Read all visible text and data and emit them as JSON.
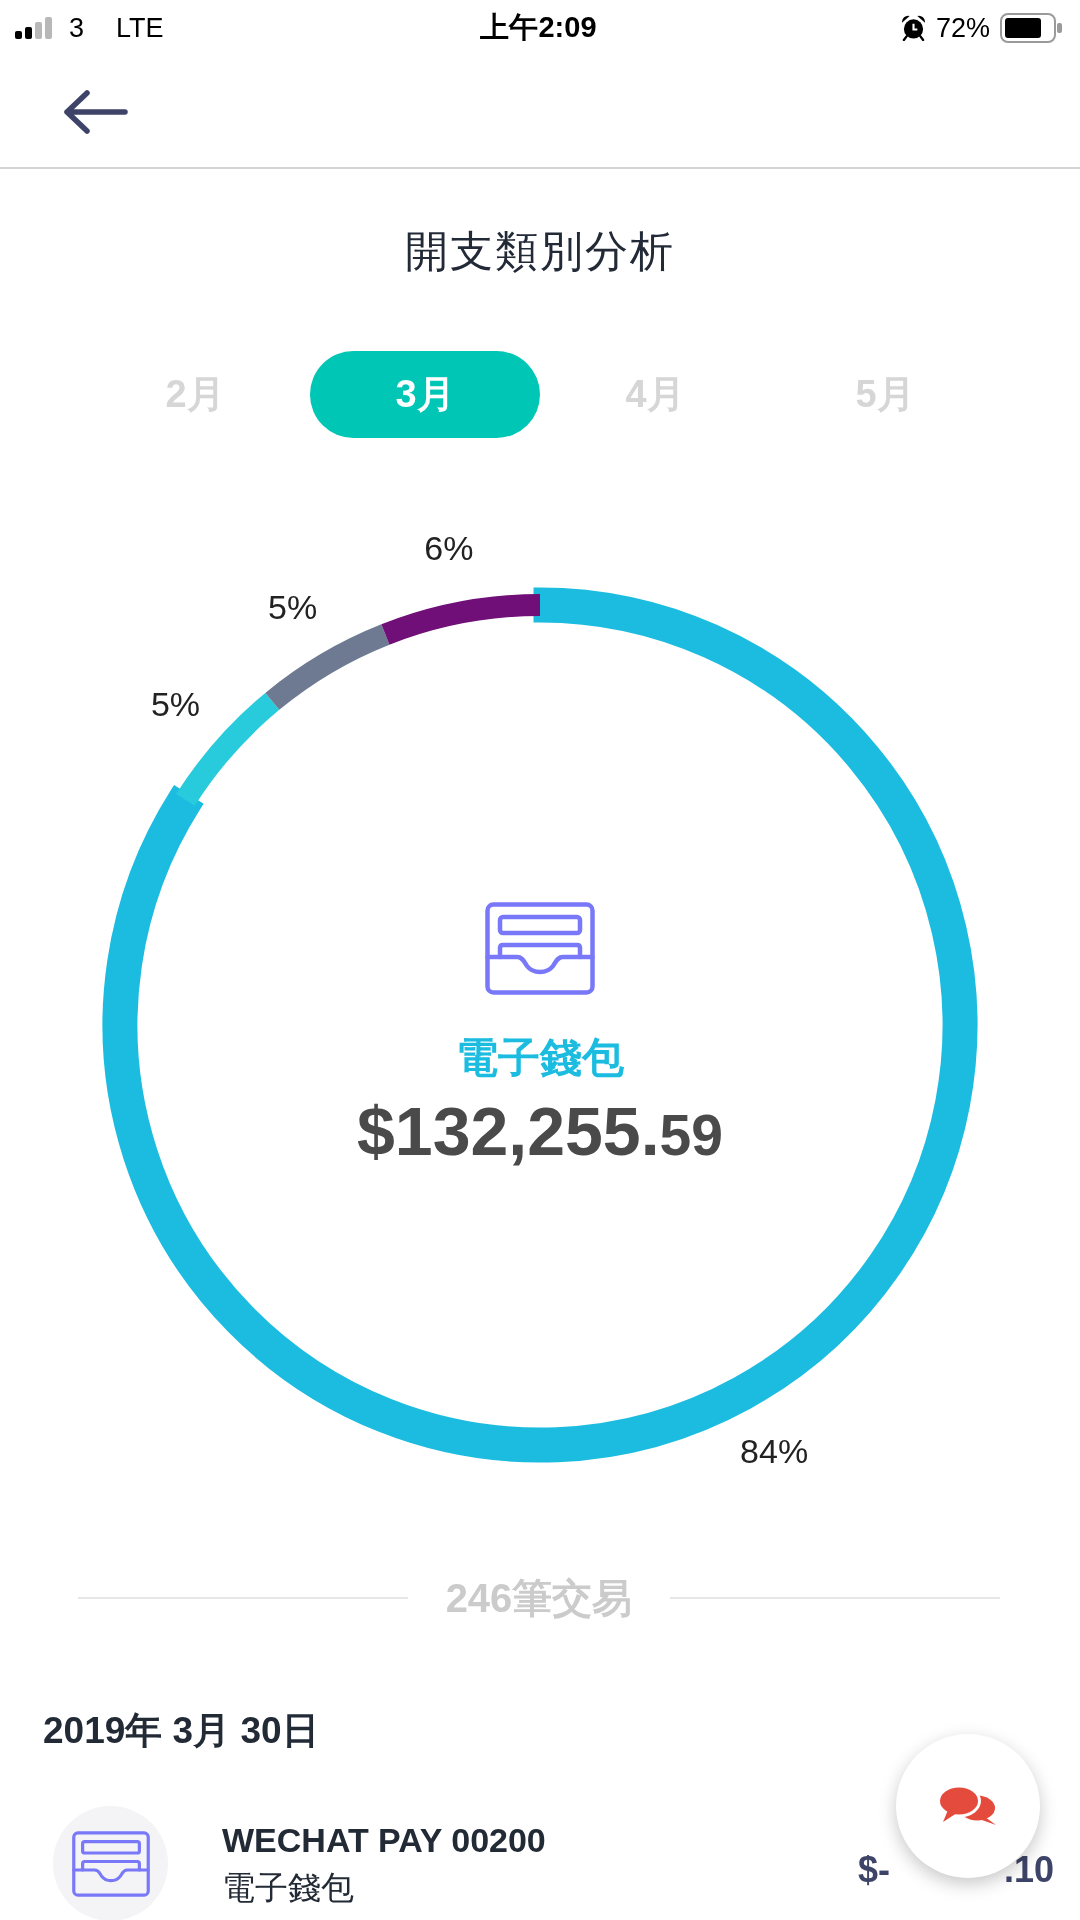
{
  "status_bar": {
    "carrier": "3",
    "network": "LTE",
    "time": "上午2:09",
    "battery": "72%"
  },
  "page_title": "開支類別分析",
  "month_tabs": [
    {
      "label": "2月",
      "selected": false
    },
    {
      "label": "3月",
      "selected": true
    },
    {
      "label": "4月",
      "selected": false
    },
    {
      "label": "5月",
      "selected": false
    }
  ],
  "chart": {
    "chart_data": {
      "type": "donut",
      "values": [
        84,
        5,
        5,
        6
      ],
      "value_labels": [
        "84%",
        "5%",
        "5%",
        "6%"
      ]
    },
    "slices": [
      {
        "color": "#1bbce0",
        "selected": true
      },
      {
        "color": "#27cbdb",
        "selected": false
      },
      {
        "color": "#6e7a92",
        "selected": false
      },
      {
        "color": "#6f0f77",
        "selected": false
      }
    ],
    "center": {
      "category": "電子錢包",
      "amount_whole": "$132,255.",
      "amount_fraction": "59"
    }
  },
  "transaction_count": "246筆交易",
  "transactions": {
    "date": "2019年 3月 30日",
    "items": [
      {
        "name": "WECHAT PAY 00200",
        "category": "電子錢包",
        "amount_start": "$-",
        "amount_end": ".10"
      }
    ]
  }
}
